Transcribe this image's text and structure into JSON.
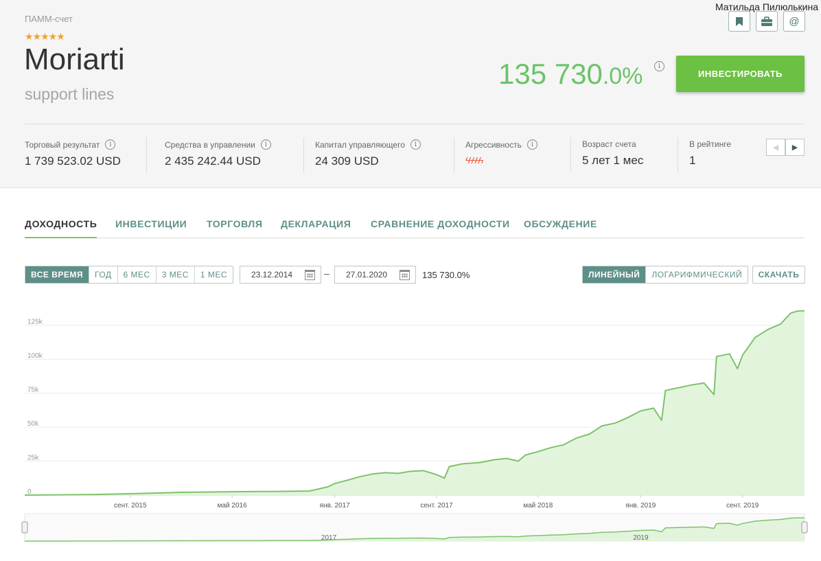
{
  "user": {
    "name": "Матильда Пилюлькина"
  },
  "header": {
    "account_type": "ПАММ-счет",
    "rating_stars": 5,
    "account_name": "Moriarti",
    "account_subtitle": "support lines",
    "return_int": "135 730",
    "return_dec": ".0%",
    "invest_label": "ИНВЕСТИРОВАТЬ"
  },
  "icons": [
    "bookmark-icon",
    "briefcase-icon",
    "at-icon"
  ],
  "stats": {
    "trade_result": {
      "label": "Торговый результат",
      "value": "1 739 523.02 USD"
    },
    "funds_managed": {
      "label": "Средства в управлении",
      "value": "2 435 242.44 USD"
    },
    "manager_capital": {
      "label": "Капитал управляющего",
      "value": "24 309 USD"
    },
    "aggressiveness": {
      "label": "Агрессивность",
      "level": 5
    },
    "account_age": {
      "label": "Возраст счета",
      "value": "5 лет 1 мес"
    },
    "ranking": {
      "label": "В рейтинге",
      "value": "1"
    }
  },
  "tabs": [
    {
      "label": "ДОХОДНОСТЬ",
      "active": true
    },
    {
      "label": "ИНВЕСТИЦИИ",
      "active": false
    },
    {
      "label": "ТОРГОВЛЯ",
      "active": false
    },
    {
      "label": "ДЕКЛАРАЦИЯ",
      "active": false
    },
    {
      "label": "СРАВНЕНИЕ ДОХОДНОСТИ",
      "active": false
    },
    {
      "label": "ОБСУЖДЕНИЕ",
      "active": false
    }
  ],
  "controls": {
    "periods": [
      {
        "label": "ВСЕ ВРЕМЯ",
        "active": true
      },
      {
        "label": "ГОД",
        "active": false
      },
      {
        "label": "6 МЕС",
        "active": false
      },
      {
        "label": "3 МЕС",
        "active": false
      },
      {
        "label": "1 МЕС",
        "active": false
      }
    ],
    "date_from": "23.12.2014",
    "date_to": "27.01.2020",
    "range_return": "135 730.0%",
    "scales": [
      {
        "label": "ЛИНЕЙНЫЙ",
        "active": true
      },
      {
        "label": "ЛОГАРИФМИЧЕСКИЙ",
        "active": false
      }
    ],
    "download_label": "СКАЧАТЬ"
  },
  "colors": {
    "accent_green": "#6cc043",
    "teal": "#5e8f88",
    "line": "#7cc36a",
    "area": "#e3f4dd"
  },
  "chart_data": {
    "type": "area",
    "x_start": "2014-12-23",
    "x_end": "2020-01-27",
    "ylim": [
      0,
      137000
    ],
    "y_ticks": [
      0,
      25000,
      50000,
      75000,
      100000,
      125000
    ],
    "y_tick_labels": [
      "0",
      "25k",
      "50k",
      "75k",
      "100k",
      "125k"
    ],
    "x_ticks": [
      {
        "date": "2015-09-01",
        "label": "сент. 2015"
      },
      {
        "date": "2016-05-01",
        "label": "май 2016"
      },
      {
        "date": "2017-01-01",
        "label": "янв. 2017"
      },
      {
        "date": "2017-09-01",
        "label": "сент. 2017"
      },
      {
        "date": "2018-05-01",
        "label": "май 2018"
      },
      {
        "date": "2019-01-01",
        "label": "янв. 2019"
      },
      {
        "date": "2019-09-01",
        "label": "сент. 2019"
      }
    ],
    "navigator_labels": [
      "2017",
      "2019"
    ],
    "series": [
      {
        "points": [
          [
            "2014-12-23",
            0
          ],
          [
            "2015-03-01",
            100
          ],
          [
            "2015-06-01",
            400
          ],
          [
            "2015-09-01",
            1000
          ],
          [
            "2016-01-01",
            2000
          ],
          [
            "2016-05-01",
            2500
          ],
          [
            "2016-08-01",
            2700
          ],
          [
            "2016-11-01",
            3000
          ],
          [
            "2016-12-15",
            6000
          ],
          [
            "2017-01-01",
            8500
          ],
          [
            "2017-02-01",
            11000
          ],
          [
            "2017-03-01",
            13500
          ],
          [
            "2017-04-01",
            15500
          ],
          [
            "2017-05-01",
            16500
          ],
          [
            "2017-06-01",
            16000
          ],
          [
            "2017-07-01",
            17500
          ],
          [
            "2017-08-01",
            18000
          ],
          [
            "2017-09-01",
            15000
          ],
          [
            "2017-09-20",
            12500
          ],
          [
            "2017-10-01",
            21000
          ],
          [
            "2017-11-01",
            23000
          ],
          [
            "2017-12-15",
            24000
          ],
          [
            "2018-01-15",
            26000
          ],
          [
            "2018-02-15",
            27000
          ],
          [
            "2018-03-15",
            25000
          ],
          [
            "2018-04-01",
            29500
          ],
          [
            "2018-05-01",
            32000
          ],
          [
            "2018-06-01",
            35000
          ],
          [
            "2018-07-01",
            37000
          ],
          [
            "2018-08-01",
            42000
          ],
          [
            "2018-09-01",
            45000
          ],
          [
            "2018-10-01",
            51000
          ],
          [
            "2018-11-01",
            53000
          ],
          [
            "2018-12-01",
            57000
          ],
          [
            "2019-01-01",
            62000
          ],
          [
            "2019-02-01",
            64000
          ],
          [
            "2019-02-20",
            55000
          ],
          [
            "2019-03-01",
            77000
          ],
          [
            "2019-04-01",
            79000
          ],
          [
            "2019-05-01",
            81000
          ],
          [
            "2019-06-01",
            82500
          ],
          [
            "2019-06-25",
            74000
          ],
          [
            "2019-07-01",
            102000
          ],
          [
            "2019-08-01",
            104000
          ],
          [
            "2019-08-20",
            93000
          ],
          [
            "2019-09-01",
            103000
          ],
          [
            "2019-10-01",
            116000
          ],
          [
            "2019-11-01",
            122000
          ],
          [
            "2019-12-01",
            126000
          ],
          [
            "2019-12-25",
            134000
          ],
          [
            "2020-01-10",
            135500
          ],
          [
            "2020-01-27",
            135730
          ]
        ]
      }
    ]
  }
}
